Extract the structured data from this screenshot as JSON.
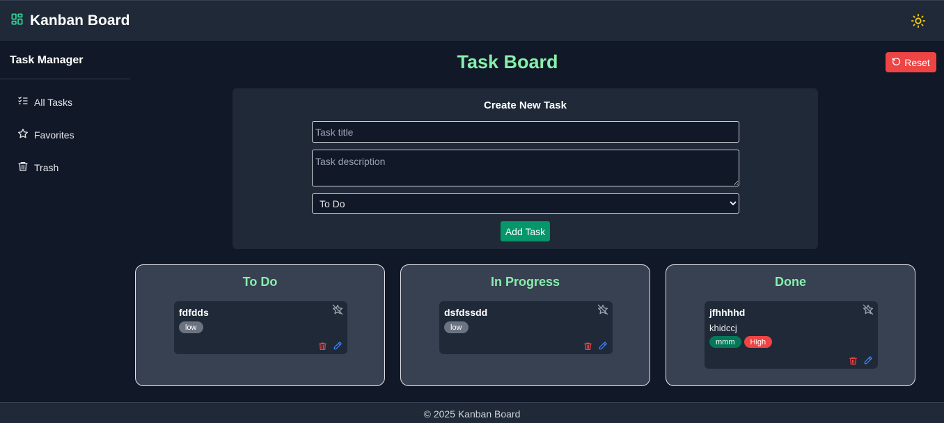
{
  "header": {
    "title": "Kanban Board",
    "logo_icon": "layout-grid-icon",
    "theme_icon": "sun-icon"
  },
  "sidebar": {
    "title": "Task Manager",
    "items": [
      {
        "label": "All Tasks",
        "icon": "list-checks-icon"
      },
      {
        "label": "Favorites",
        "icon": "star-icon"
      },
      {
        "label": "Trash",
        "icon": "trash-icon"
      }
    ]
  },
  "main": {
    "title": "Task Board",
    "reset_label": "Reset"
  },
  "create": {
    "heading": "Create New Task",
    "title_placeholder": "Task title",
    "desc_placeholder": "Task description",
    "status_value": "To Do",
    "status_options": [
      "To Do"
    ],
    "add_label": "Add Task"
  },
  "columns": [
    {
      "title": "To Do",
      "cards": [
        {
          "title": "fdfdds",
          "description": "",
          "tags": [
            {
              "label": "low",
              "color": "#6b7280"
            }
          ]
        }
      ]
    },
    {
      "title": "In Progress",
      "cards": [
        {
          "title": "dsfdssdd",
          "description": "",
          "tags": [
            {
              "label": "low",
              "color": "#6b7280"
            }
          ]
        }
      ]
    },
    {
      "title": "Done",
      "cards": [
        {
          "title": "jfhhhhd",
          "description": "khidccj",
          "tags": [
            {
              "label": "mmm",
              "color": "#047857"
            },
            {
              "label": "High",
              "color": "#ef4444"
            }
          ]
        }
      ]
    }
  ],
  "footer": {
    "text": "© 2025 Kanban Board"
  },
  "colors": {
    "accent": "#86efac",
    "danger": "#ef4444",
    "success": "#059669",
    "edit": "#3b82f6"
  }
}
